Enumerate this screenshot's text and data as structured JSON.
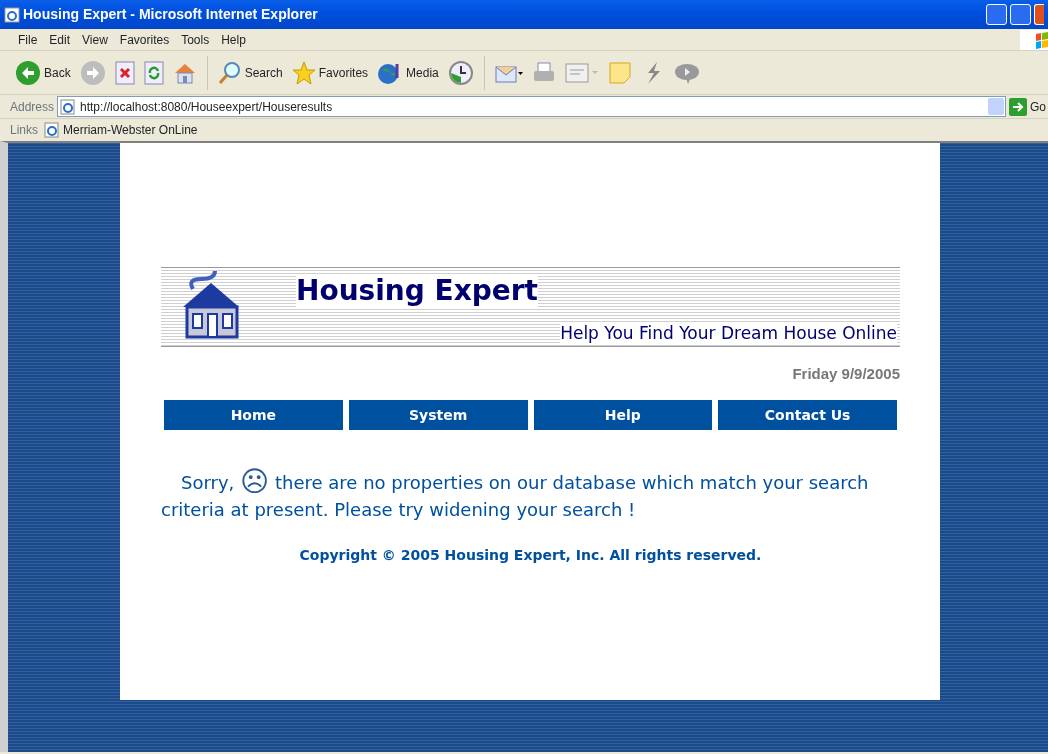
{
  "window": {
    "title": "Housing Expert - Microsoft Internet Explorer"
  },
  "menu": [
    "File",
    "Edit",
    "View",
    "Favorites",
    "Tools",
    "Help"
  ],
  "toolbar": [
    {
      "kind": "back",
      "label": "Back"
    },
    {
      "kind": "forward"
    },
    {
      "kind": "stop"
    },
    {
      "kind": "refresh"
    },
    {
      "kind": "home"
    },
    {
      "kind": "search",
      "label": "Search"
    },
    {
      "kind": "favorites",
      "label": "Favorites"
    },
    {
      "kind": "media",
      "label": "Media"
    },
    {
      "kind": "history"
    },
    {
      "kind": "mail"
    },
    {
      "kind": "print"
    },
    {
      "kind": "edit"
    },
    {
      "kind": "note"
    },
    {
      "kind": "bolt"
    },
    {
      "kind": "messenger"
    }
  ],
  "address": {
    "label": "Address",
    "url": "http://localhost:8080/Houseexpert/Houseresults",
    "go": "Go"
  },
  "links": {
    "label": "Links",
    "items": [
      "Merriam-Webster OnLine"
    ]
  },
  "page": {
    "site_title": "Housing Expert",
    "tagline": "Help You Find Your Dream House Online",
    "date": "Friday 9/9/2005",
    "nav": [
      "Home",
      "System",
      "Help",
      "Contact Us"
    ],
    "message": {
      "lead": "Sorry,",
      "face": "☹",
      "text": "there are no properties on our database which match your search criteria at present. Please try widening your search !"
    },
    "copyright": "Copyright © 2005  Housing Expert, Inc. All rights reserved."
  }
}
